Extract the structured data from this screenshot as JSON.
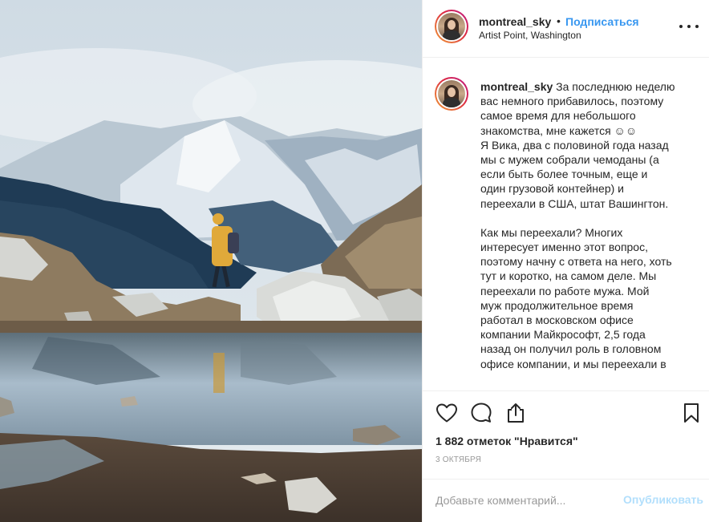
{
  "header": {
    "username": "montreal_sky",
    "separator": "•",
    "follow_label": "Подписаться",
    "location": "Artist Point, Washington"
  },
  "caption": {
    "username": "montreal_sky",
    "paragraph1_first_line": "За последнюю неделю",
    "paragraph1_lines": [
      "вас немного прибавилось, поэтому",
      "самое время для небольшого",
      "знакомства, мне кажется ☺☺",
      "Я Вика, два с половиной года назад",
      "мы с мужем собрали чемоданы (а",
      "если быть более точным, еще и",
      "один грузовой контейнер) и",
      "переехали в США, штат Вашингтон."
    ],
    "paragraph2_lines": [
      "Как мы переехали? Многих",
      "интересует именно этот вопрос,",
      "поэтому начну с ответа на него, хоть",
      "тут и коротко, на самом деле. Мы",
      "переехали по работе мужа. Мой",
      "муж продолжительное время",
      "работал в московском офисе",
      "компании Майкрософт, 2,5 года",
      "назад он получил роль в головном",
      "офисе компании, и мы переехали в"
    ]
  },
  "actions": {
    "likes_text": "1 882 отметок \"Нравится\"",
    "date": "3 октября"
  },
  "comment": {
    "placeholder": "Добавьте комментарий...",
    "publish_label": "Опубликовать"
  },
  "colors": {
    "link_blue": "#3897f0",
    "publish_disabled": "#b2dffc",
    "text": "#262626",
    "muted": "#999999",
    "divider": "#efefef"
  },
  "icons": {
    "like": "heart-outline-icon",
    "comment": "speech-bubble-icon",
    "share": "share-upload-icon",
    "save": "bookmark-icon",
    "more": "more-dots-icon"
  }
}
